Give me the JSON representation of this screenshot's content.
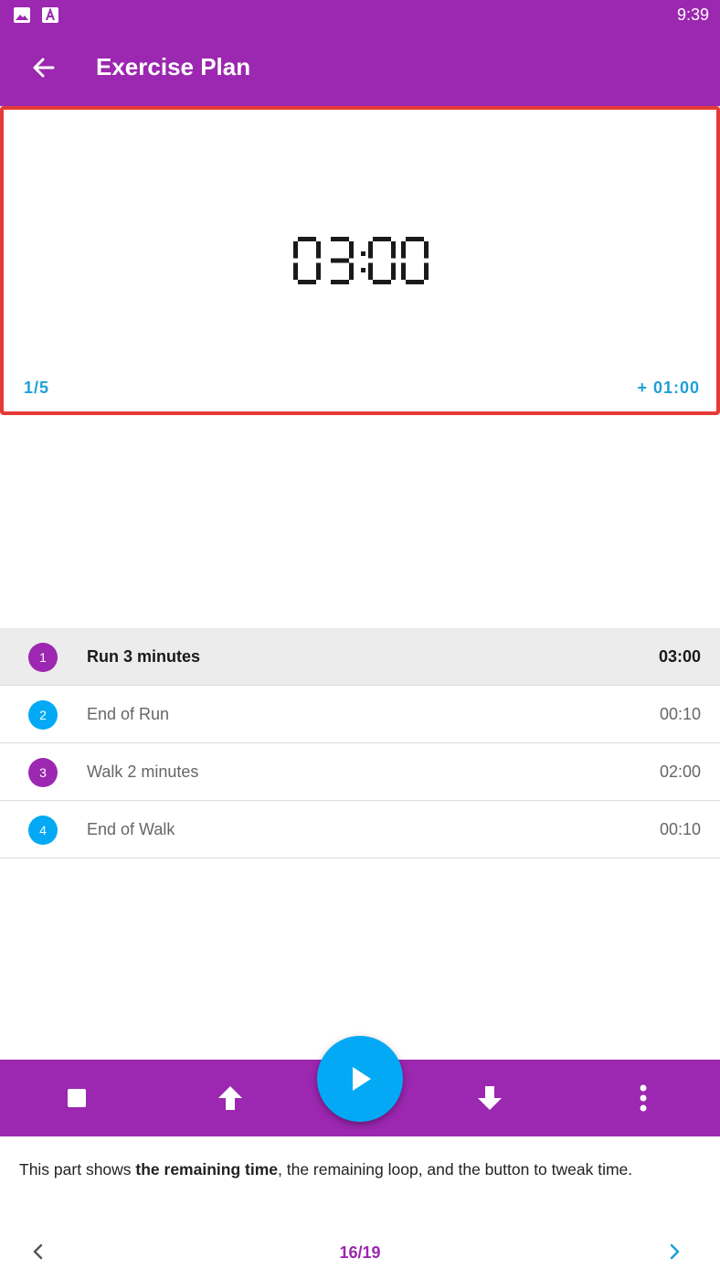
{
  "status_bar": {
    "time": "9:39",
    "icons": [
      "image-icon",
      "font-a-icon"
    ]
  },
  "app_bar": {
    "title": "Exercise Plan",
    "back_icon": "arrow-left-icon"
  },
  "timer": {
    "remaining": "03:00",
    "loop": "1/5",
    "tweak": "+ 01:00"
  },
  "steps": [
    {
      "number": "1",
      "name": "Run 3 minutes",
      "time": "03:00",
      "color": "#9c27b0",
      "active": true
    },
    {
      "number": "2",
      "name": "End of Run",
      "time": "00:10",
      "color": "#03a9f4",
      "active": false
    },
    {
      "number": "3",
      "name": "Walk 2 minutes",
      "time": "02:00",
      "color": "#9c27b0",
      "active": false
    },
    {
      "number": "4",
      "name": "End of Walk",
      "time": "00:10",
      "color": "#03a9f4",
      "active": false
    }
  ],
  "controls": {
    "icons": [
      "stop-icon",
      "arrow-up-icon",
      "play-icon",
      "arrow-down-icon",
      "more-vertical-icon"
    ]
  },
  "tutorial": {
    "desc_pre": "This part shows ",
    "desc_bold": "the remaining time",
    "desc_post": ", the remaining loop, and the button to tweak time.",
    "page": "16/19",
    "prev_icon": "chevron-left-icon",
    "next_icon": "chevron-right-icon"
  },
  "colors": {
    "primary": "#9c27b0",
    "accent": "#03a9f4",
    "highlight_border": "#e53935"
  }
}
